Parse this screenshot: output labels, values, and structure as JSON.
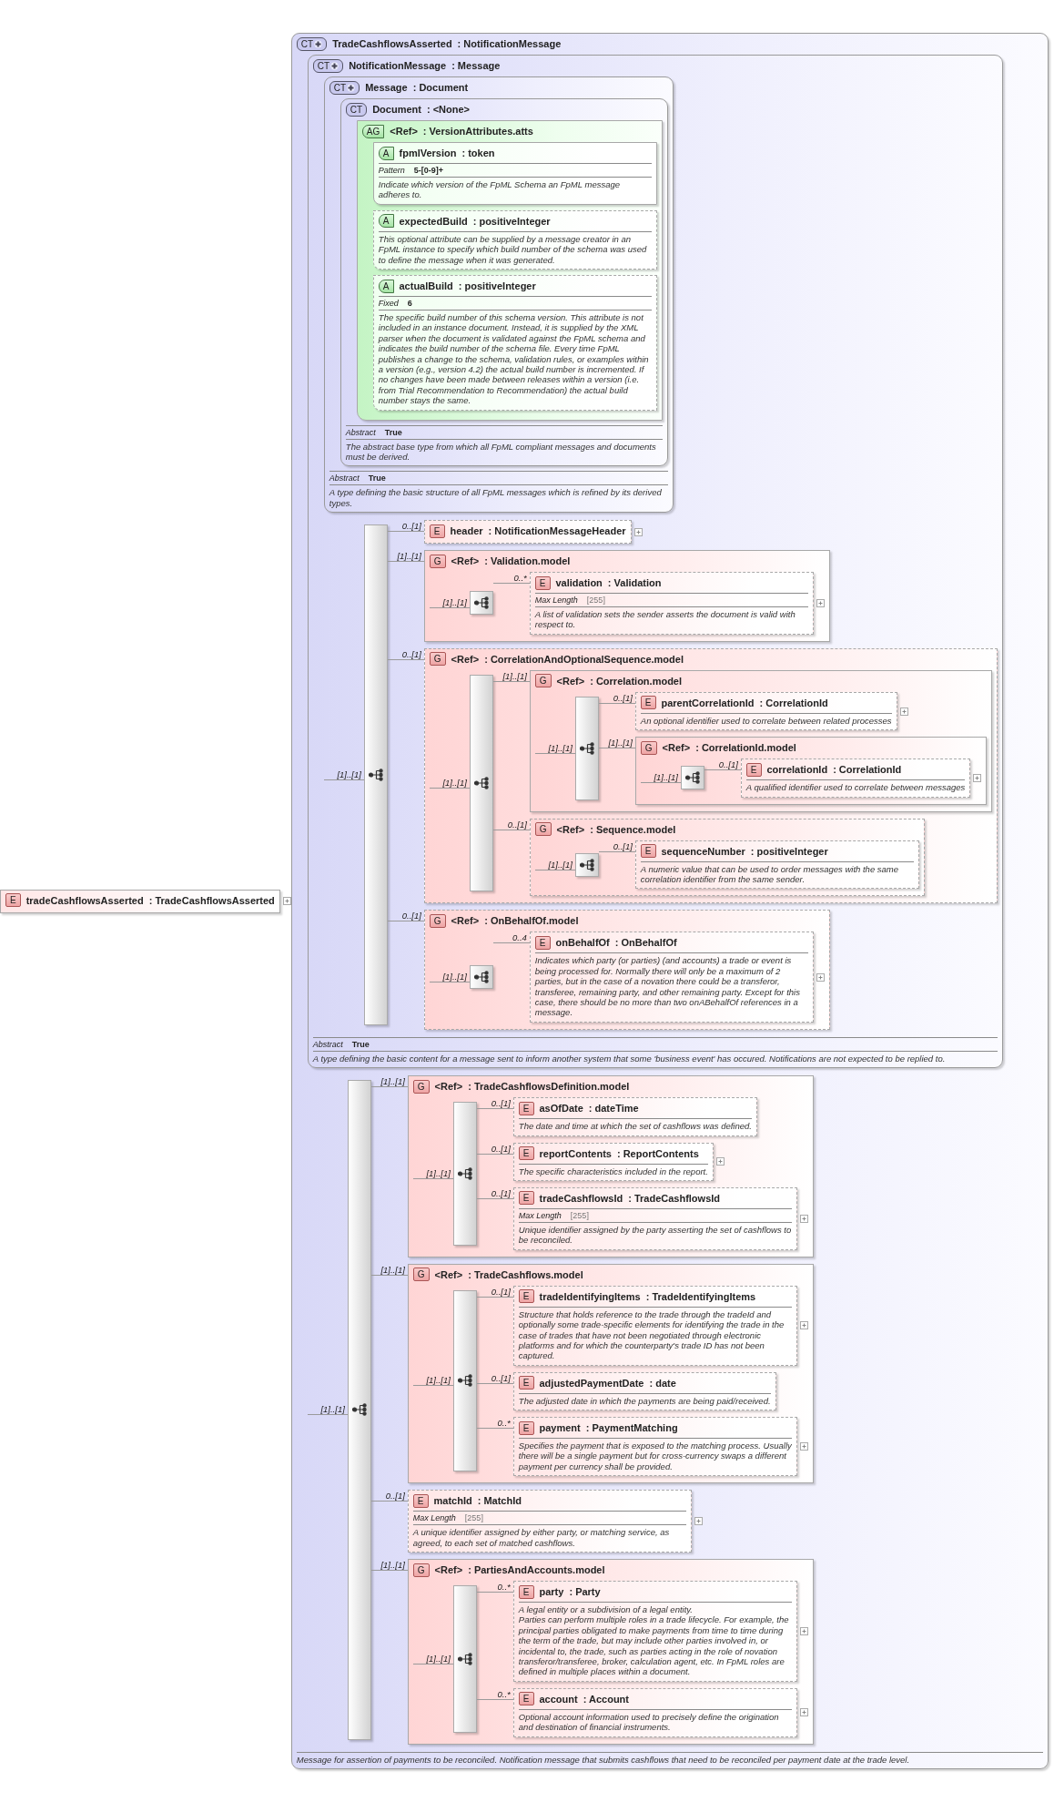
{
  "root_element": {
    "kind": "element",
    "badge": "E",
    "name": "tradeCashflowsAsserted",
    "type": ": TradeCashflowsAsserted",
    "expandable": true
  },
  "complex_type": {
    "kind": "complex_type",
    "badge": "CT",
    "derived": true,
    "name": "TradeCashflowsAsserted",
    "type": ": NotificationMessage",
    "content": [
      {
        "kind": "complex_type",
        "badge": "CT",
        "derived": true,
        "name": "NotificationMessage",
        "type": ": Message",
        "content": [
          {
            "kind": "complex_type",
            "badge": "CT",
            "derived": true,
            "name": "Message",
            "type": ": Document",
            "content": [
              {
                "kind": "complex_type",
                "badge": "CT",
                "derived": false,
                "name": "Document",
                "type": ": <None>",
                "content": [
                  {
                    "kind": "attribute_group",
                    "badge": "AG",
                    "name": "<Ref>",
                    "type": ": VersionAttributes.atts",
                    "content": [
                      {
                        "kind": "attribute",
                        "badge": "A",
                        "name": "fpmlVersion",
                        "type": ": token",
                        "optional": false,
                        "facets": [
                          {
                            "label": "Pattern",
                            "value": "5-[0-9]+"
                          }
                        ],
                        "description": "Indicate which version of the FpML Schema an FpML message adheres to."
                      },
                      {
                        "kind": "attribute",
                        "badge": "A",
                        "name": "expectedBuild",
                        "type": ": positiveInteger",
                        "optional": true,
                        "description": "This optional attribute can be supplied by a message creator in an FpML instance to specify which build number of the schema was used to define the message when it was generated."
                      },
                      {
                        "kind": "attribute",
                        "badge": "A",
                        "name": "actualBuild",
                        "type": ": positiveInteger",
                        "optional": true,
                        "facets": [
                          {
                            "label": "Fixed",
                            "value": "6"
                          }
                        ],
                        "description": "The specific build number of this schema version. This attribute is not included in an instance document. Instead, it is supplied by the XML parser when the document is validated against the FpML schema and indicates the build number of the schema file. Every time FpML publishes a change to the schema, validation rules, or examples within a version (e.g., version 4.2) the actual build number is incremented. If no changes have been made between releases within a version (i.e. from Trial Recommendation to Recommendation) the actual build number stays the same."
                      }
                    ]
                  }
                ],
                "facets": [
                  {
                    "label": "Abstract",
                    "value": "True"
                  }
                ],
                "description": "The abstract base type from which all FpML compliant messages and documents must be derived."
              }
            ],
            "facets": [
              {
                "label": "Abstract",
                "value": "True"
              }
            ],
            "description": "A type defining the basic structure of all FpML messages which is refined by its derived types."
          },
          {
            "kind": "sequence",
            "occurs": "[1]..[1]",
            "items": [
              {
                "kind": "element",
                "occurs": "0..[1]",
                "badge": "E",
                "name": "header",
                "type": ": NotificationMessageHeader",
                "optional": true,
                "expandable": true
              },
              {
                "kind": "group",
                "occurs": "[1]..[1]",
                "badge": "G",
                "name": "<Ref>",
                "type": ": Validation.model",
                "optional": false,
                "content": [
                  {
                    "kind": "sequence",
                    "occurs": "[1]..[1]",
                    "items": [
                      {
                        "kind": "element",
                        "occurs": "0..*",
                        "badge": "E",
                        "name": "validation",
                        "type": ": Validation",
                        "optional": true,
                        "expandable": true,
                        "facets": [
                          {
                            "label": "Max Length",
                            "value": "[255]"
                          }
                        ],
                        "description": "A list of validation sets the sender asserts the document is valid with respect to."
                      }
                    ]
                  }
                ]
              },
              {
                "kind": "group",
                "occurs": "0..[1]",
                "badge": "G",
                "name": "<Ref>",
                "type": ": CorrelationAndOptionalSequence.model",
                "optional": true,
                "content": [
                  {
                    "kind": "sequence",
                    "occurs": "[1]..[1]",
                    "items": [
                      {
                        "kind": "group",
                        "occurs": "[1]..[1]",
                        "badge": "G",
                        "name": "<Ref>",
                        "type": ": Correlation.model",
                        "optional": false,
                        "content": [
                          {
                            "kind": "sequence",
                            "occurs": "[1]..[1]",
                            "items": [
                              {
                                "kind": "element",
                                "occurs": "0..[1]",
                                "badge": "E",
                                "name": "parentCorrelationId",
                                "type": ": CorrelationId",
                                "optional": true,
                                "expandable": true,
                                "description": "An optional identifier used to correlate between related processes"
                              },
                              {
                                "kind": "group",
                                "occurs": "[1]..[1]",
                                "badge": "G",
                                "name": "<Ref>",
                                "type": ": CorrelationId.model",
                                "optional": false,
                                "content": [
                                  {
                                    "kind": "sequence",
                                    "occurs": "[1]..[1]",
                                    "items": [
                                      {
                                        "kind": "element",
                                        "occurs": "0..[1]",
                                        "badge": "E",
                                        "name": "correlationId",
                                        "type": ": CorrelationId",
                                        "optional": true,
                                        "expandable": true,
                                        "description": "A qualified identifier used to correlate between messages"
                                      }
                                    ]
                                  }
                                ]
                              }
                            ]
                          }
                        ]
                      },
                      {
                        "kind": "group",
                        "occurs": "0..[1]",
                        "badge": "G",
                        "name": "<Ref>",
                        "type": ": Sequence.model",
                        "optional": true,
                        "content": [
                          {
                            "kind": "sequence",
                            "occurs": "[1]..[1]",
                            "items": [
                              {
                                "kind": "element",
                                "occurs": "0..[1]",
                                "badge": "E",
                                "name": "sequenceNumber",
                                "type": ": positiveInteger",
                                "optional": true,
                                "expandable": false,
                                "description": "A numeric value that can be used to order messages with the same correlation identifier from the same sender."
                              }
                            ]
                          }
                        ]
                      }
                    ]
                  }
                ]
              },
              {
                "kind": "group",
                "occurs": "0..[1]",
                "badge": "G",
                "name": "<Ref>",
                "type": ": OnBehalfOf.model",
                "optional": true,
                "content": [
                  {
                    "kind": "sequence",
                    "occurs": "[1]..[1]",
                    "items": [
                      {
                        "kind": "element",
                        "occurs": "0..4",
                        "badge": "E",
                        "name": "onBehalfOf",
                        "type": ": OnBehalfOf",
                        "optional": true,
                        "expandable": true,
                        "description": "Indicates which party (or parties) (and accounts) a trade or event is being processed for. Normally there will only be a maximum of 2 parties, but in the case of a novation there could be a transferor, transferee, remaining party, and other remaining party. Except for this case, there should be no more than two onABehalfOf references in a message."
                      }
                    ]
                  }
                ]
              }
            ]
          }
        ],
        "facets": [
          {
            "label": "Abstract",
            "value": "True"
          }
        ],
        "description": "A type defining the basic content for a message sent to inform another system that some 'business event' has occured. Notifications are not expected to be replied to."
      },
      {
        "kind": "sequence",
        "occurs": "[1]..[1]",
        "items": [
          {
            "kind": "group",
            "occurs": "[1]..[1]",
            "badge": "G",
            "name": "<Ref>",
            "type": ": TradeCashflowsDefinition.model",
            "optional": false,
            "content": [
              {
                "kind": "sequence",
                "occurs": "[1]..[1]",
                "items": [
                  {
                    "kind": "element",
                    "occurs": "0..[1]",
                    "badge": "E",
                    "name": "asOfDate",
                    "type": ": dateTime",
                    "optional": true,
                    "expandable": false,
                    "description": "The date and time at which the set of cashflows was defined."
                  },
                  {
                    "kind": "element",
                    "occurs": "0..[1]",
                    "badge": "E",
                    "name": "reportContents",
                    "type": ": ReportContents",
                    "optional": true,
                    "expandable": true,
                    "description": "The specific characteristics included in the report."
                  },
                  {
                    "kind": "element",
                    "occurs": "0..[1]",
                    "badge": "E",
                    "name": "tradeCashflowsId",
                    "type": ": TradeCashflowsId",
                    "optional": true,
                    "expandable": true,
                    "facets": [
                      {
                        "label": "Max Length",
                        "value": "[255]"
                      }
                    ],
                    "description": "Unique identifier assigned by the party asserting the set of cashflows to be reconciled."
                  }
                ]
              }
            ]
          },
          {
            "kind": "group",
            "occurs": "[1]..[1]",
            "badge": "G",
            "name": "<Ref>",
            "type": ": TradeCashflows.model",
            "optional": false,
            "content": [
              {
                "kind": "sequence",
                "occurs": "[1]..[1]",
                "items": [
                  {
                    "kind": "element",
                    "occurs": "0..[1]",
                    "badge": "E",
                    "name": "tradeIdentifyingItems",
                    "type": ": TradeIdentifyingItems",
                    "optional": true,
                    "expandable": true,
                    "description": "Structure that holds reference to the trade through the tradeId and optionally some trade-specific elements for identifying the trade in the case of trades that have not been negotiated through electronic platforms and for which the counterparty's trade ID has not been captured."
                  },
                  {
                    "kind": "element",
                    "occurs": "0..[1]",
                    "badge": "E",
                    "name": "adjustedPaymentDate",
                    "type": ": date",
                    "optional": true,
                    "expandable": false,
                    "description": "The adjusted date in which the payments are being paid/received."
                  },
                  {
                    "kind": "element",
                    "occurs": "0..*",
                    "badge": "E",
                    "name": "payment",
                    "type": ": PaymentMatching",
                    "optional": true,
                    "expandable": true,
                    "description": "Specifies the payment that is exposed to the matching process. Usually there will be a single payment but for cross-currency swaps a different payment per currency shall be provided."
                  }
                ]
              }
            ]
          },
          {
            "kind": "element",
            "occurs": "0..[1]",
            "badge": "E",
            "name": "matchId",
            "type": ": MatchId",
            "optional": true,
            "expandable": true,
            "facets": [
              {
                "label": "Max Length",
                "value": "[255]"
              }
            ],
            "description": "A unique identifier assigned by either party, or matching service, as agreed, to each set of matched cashflows."
          },
          {
            "kind": "group",
            "occurs": "[1]..[1]",
            "badge": "G",
            "name": "<Ref>",
            "type": ": PartiesAndAccounts.model",
            "optional": false,
            "content": [
              {
                "kind": "sequence",
                "occurs": "[1]..[1]",
                "items": [
                  {
                    "kind": "element",
                    "occurs": "0..*",
                    "badge": "E",
                    "name": "party",
                    "type": ": Party",
                    "optional": true,
                    "expandable": true,
                    "description": "A legal entity or a subdivision of a legal entity.\nParties can perform multiple roles in a trade lifecycle. For example, the principal parties obligated to make payments from time to time during the term of the trade, but may include other parties involved in, or incidental to, the trade, such as parties acting in the role of novation transferor/transferee, broker, calculation agent, etc. In FpML roles are defined in multiple places within a document."
                  },
                  {
                    "kind": "element",
                    "occurs": "0..*",
                    "badge": "E",
                    "name": "account",
                    "type": ": Account",
                    "optional": true,
                    "expandable": true,
                    "description": "Optional account information used to precisely define the origination and destination of financial instruments."
                  }
                ]
              }
            ]
          }
        ]
      }
    ],
    "description": "Message for assertion of payments to be reconciled. Notification message that submits cashflows that need to be reconciled per payment date at the trade level."
  }
}
